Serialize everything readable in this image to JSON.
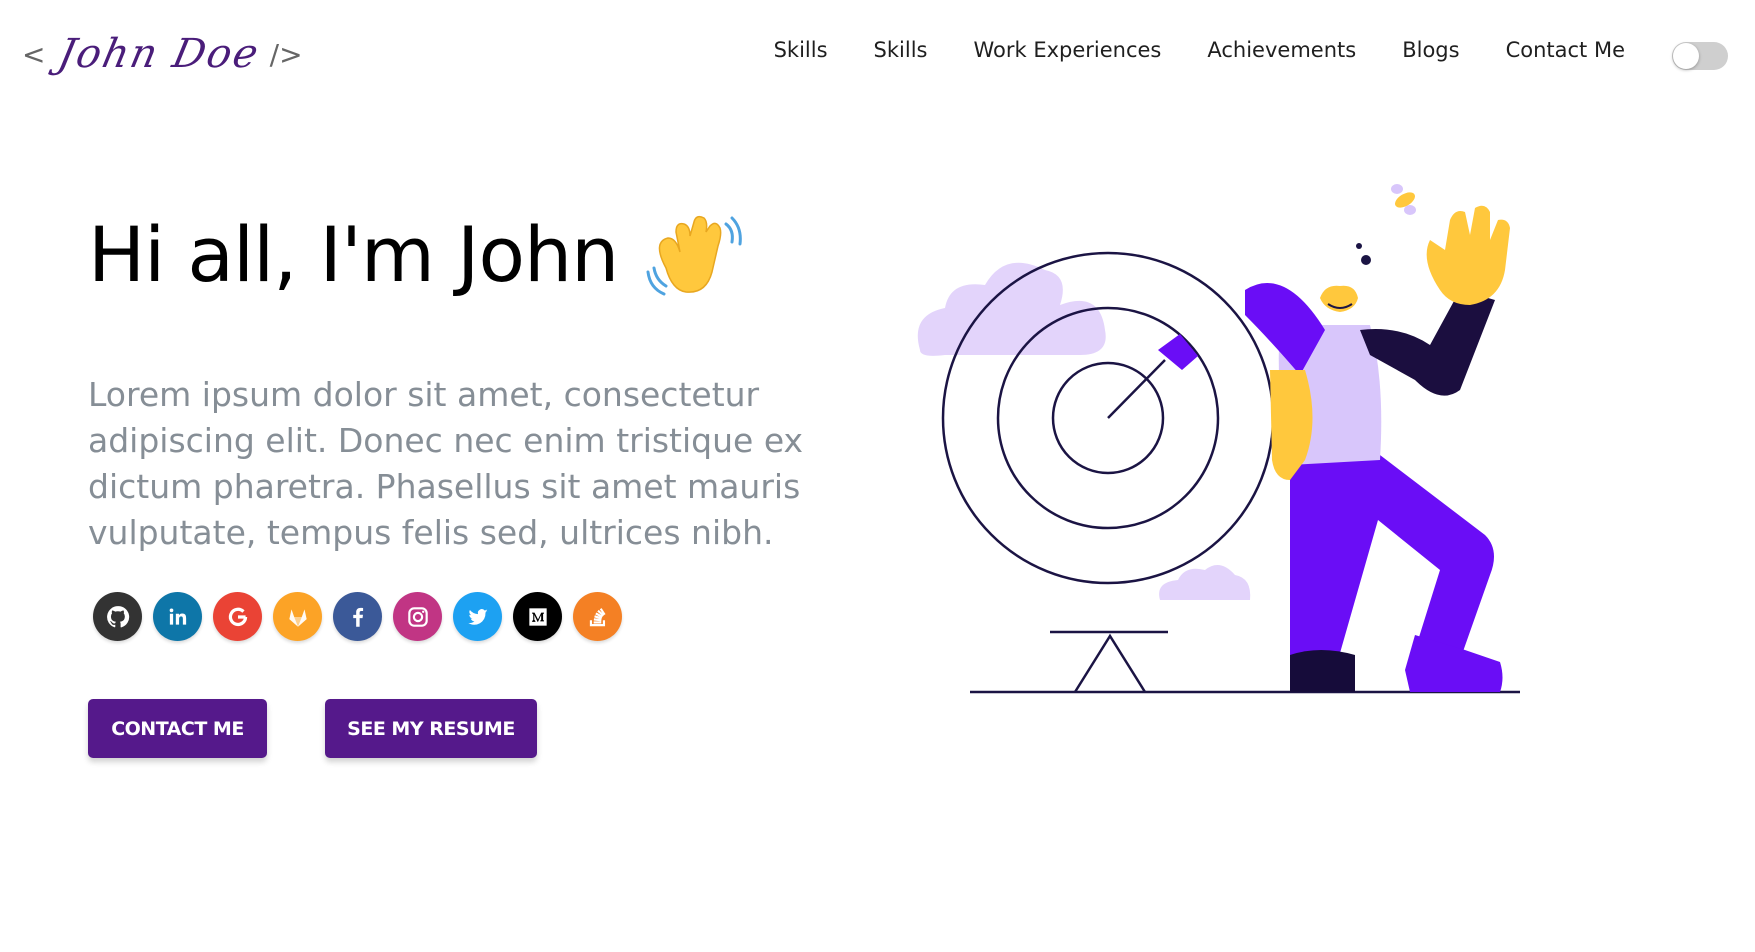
{
  "header": {
    "logo": {
      "open": "<",
      "signature": "John Doe",
      "close": "/>"
    },
    "nav": [
      "Skills",
      "Skills",
      "Work Experiences",
      "Achievements",
      "Blogs",
      "Contact Me"
    ],
    "theme_toggle": {
      "state": "off"
    }
  },
  "hero": {
    "greeting": "Hi all, I'm John",
    "greeting_emoji": "waving-hand",
    "subtitle": "Lorem ipsum dolor sit amet, consectetur adipiscing elit. Donec nec enim tristique ex dictum pharetra. Phasellus sit amet mauris vulputate, tempus felis sed, ultrices nibh.",
    "socials": [
      {
        "icon": "github-icon",
        "color": "#333333"
      },
      {
        "icon": "linkedin-icon",
        "color": "#0e76a8"
      },
      {
        "icon": "google-icon",
        "color": "#ea4335"
      },
      {
        "icon": "gitlab-icon",
        "color": "#fca326"
      },
      {
        "icon": "facebook-icon",
        "color": "#3b5998"
      },
      {
        "icon": "instagram-icon",
        "color": "#c13584"
      },
      {
        "icon": "twitter-icon",
        "color": "#1da1f2"
      },
      {
        "icon": "medium-icon",
        "color": "#000000"
      },
      {
        "icon": "stackoverflow-icon",
        "color": "#f48024"
      }
    ],
    "buttons": {
      "contact": "CONTACT ME",
      "resume": "SEE MY RESUME"
    },
    "accent": "#55198b"
  }
}
